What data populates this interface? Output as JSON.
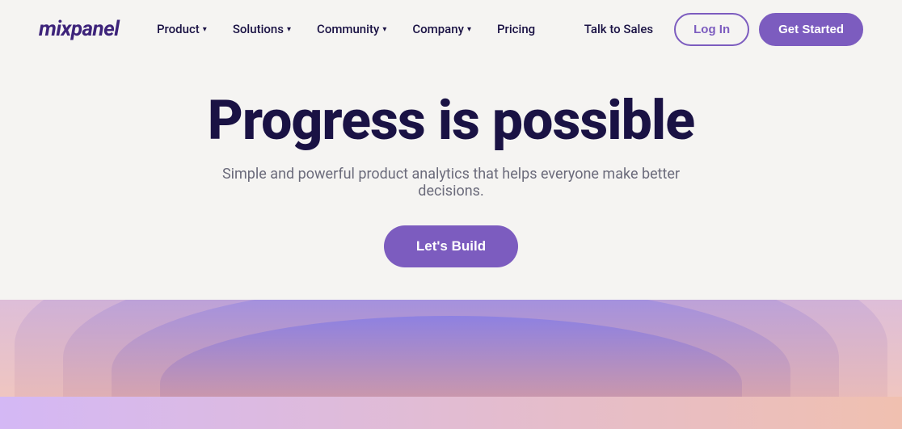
{
  "logo": {
    "text": "mixpanel"
  },
  "nav": {
    "links": [
      {
        "label": "Product",
        "has_dropdown": true
      },
      {
        "label": "Solutions",
        "has_dropdown": true
      },
      {
        "label": "Community",
        "has_dropdown": true
      },
      {
        "label": "Company",
        "has_dropdown": true
      },
      {
        "label": "Pricing",
        "has_dropdown": false
      }
    ],
    "talk_to_sales_label": "Talk to Sales",
    "login_label": "Log In",
    "get_started_label": "Get Started"
  },
  "hero": {
    "title": "Progress is possible",
    "subtitle": "Simple and powerful product analytics that helps everyone make better decisions.",
    "cta_label": "Let's Build"
  },
  "colors": {
    "primary": "#7c5cbf",
    "text_dark": "#1a1244",
    "text_muted": "#6b6b7b",
    "bg": "#f5f4f2"
  }
}
